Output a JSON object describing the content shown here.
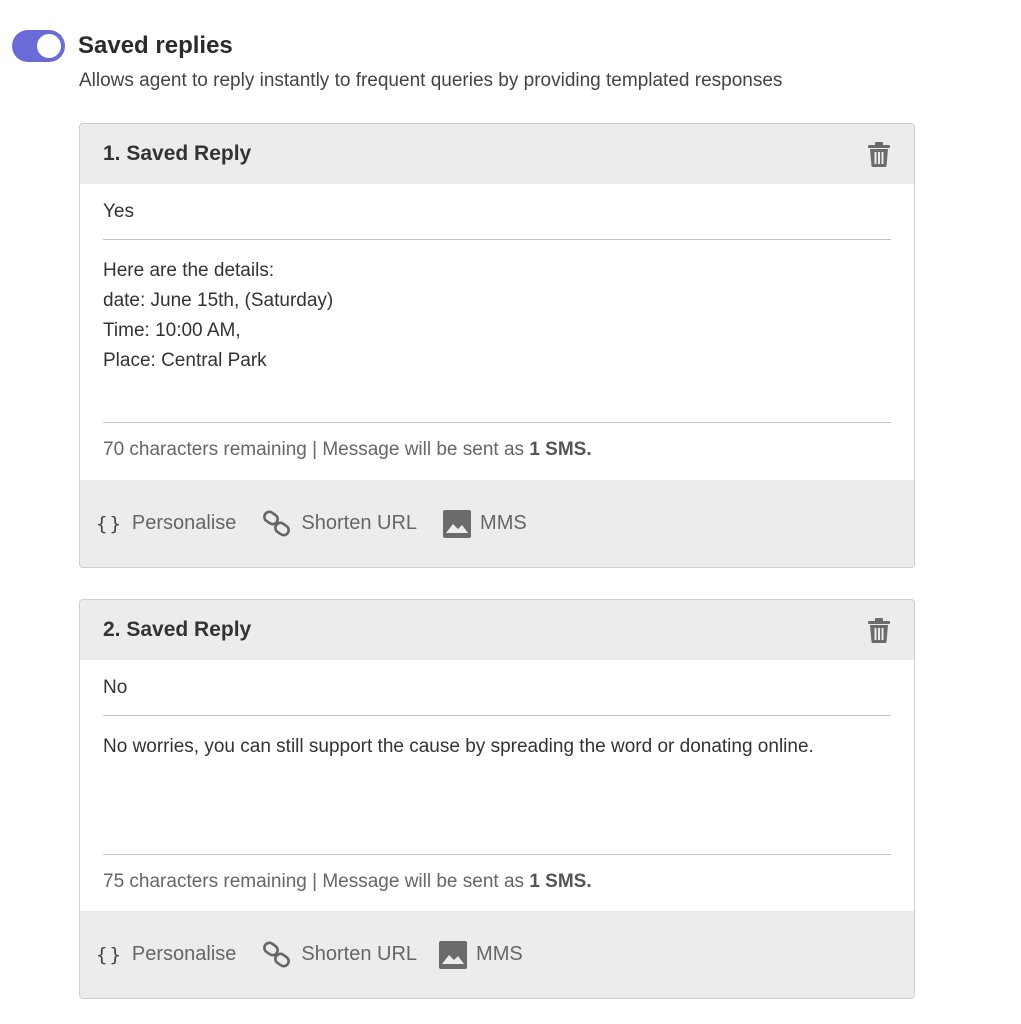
{
  "section": {
    "toggle_on": true,
    "accent_color": "#6a6bd6",
    "title": "Saved replies",
    "description": "Allows agent to reply instantly to frequent queries by providing templated responses"
  },
  "replies": [
    {
      "title": "1. Saved Reply",
      "keyword": "Yes",
      "message": "Here are the details:\ndate: June 15th, (Saturday)\nTime: 10:00 AM,\nPlace: Central Park",
      "counter_prefix": "70 characters remaining | Message will be sent as ",
      "counter_sms": "1 SMS.",
      "tools": {
        "personalise": "Personalise",
        "shorten_url": "Shorten URL",
        "mms": "MMS"
      }
    },
    {
      "title": "2.  Saved Reply",
      "keyword": "No",
      "message": "No worries, you can still support the cause by spreading the word or donating online.",
      "counter_prefix": "75 characters remaining | Message will be sent as ",
      "counter_sms": "1 SMS.",
      "tools": {
        "personalise": "Personalise",
        "shorten_url": "Shorten URL",
        "mms": "MMS"
      }
    }
  ],
  "icons": {
    "toggle": "toggle-switch",
    "delete": "trash-icon",
    "personalise": "braces-icon",
    "shorten_url": "link-icon",
    "mms": "image-icon"
  }
}
